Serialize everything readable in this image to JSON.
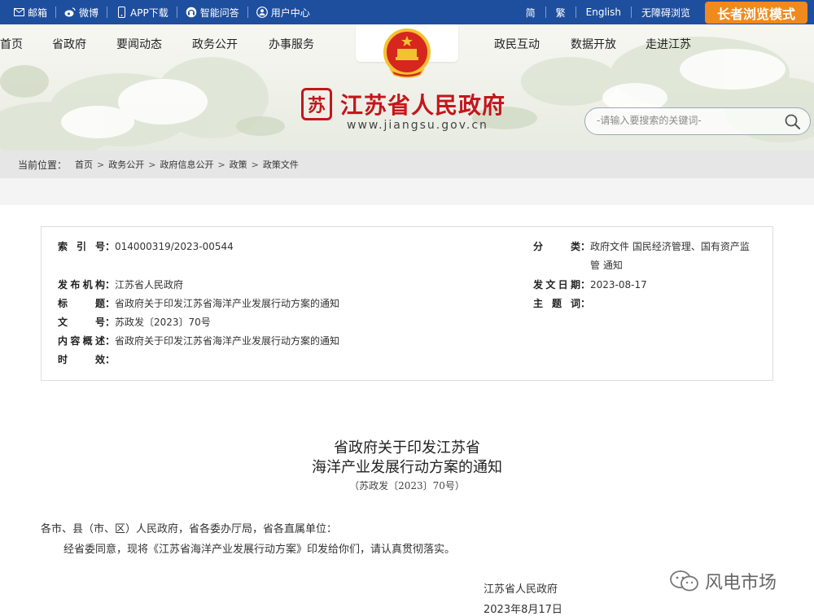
{
  "topbar": {
    "left": [
      "邮箱",
      "微博",
      "APP下载",
      "智能问答",
      "用户中心"
    ],
    "right": [
      "简",
      "繁",
      "English",
      "无障碍浏览"
    ],
    "elder": "长者浏览模式"
  },
  "nav": {
    "left": [
      "首页",
      "省政府",
      "要闻动态",
      "政务公开",
      "办事服务"
    ],
    "right": [
      "政民互动",
      "数据开放",
      "走进江苏"
    ]
  },
  "logo": {
    "seal": "苏",
    "name": "江苏省人民政府",
    "url": "www.jiangsu.gov.cn"
  },
  "search": {
    "placeholder": "-请输入要搜索的关键词-"
  },
  "breadcrumb": {
    "label": "当前位置：",
    "items": [
      "首页",
      "政务公开",
      "政府信息公开",
      "政策",
      "政策文件"
    ]
  },
  "meta": {
    "index_k": "索引号",
    "index_v": "014000319/2023-00544",
    "cat_k": "分类",
    "cat_v1": "政府文件 国民经济管理、国有资产监",
    "cat_v2": "管 通知",
    "issuer_k": "发布机构",
    "issuer_v": "江苏省人民政府",
    "date_k": "发文日期",
    "date_v": "2023-08-17",
    "title_k": "标题",
    "title_v": "省政府关于印发江苏省海洋产业发展行动方案的通知",
    "subject_k": "主题词",
    "subject_v": "",
    "docno_k": "文号",
    "docno_v": "苏政发〔2023〕70号",
    "summary_k": "内容概述",
    "summary_v": "省政府关于印发江苏省海洋产业发展行动方案的通知",
    "valid_k": "时效",
    "valid_v": ""
  },
  "doc": {
    "title1": "省政府关于印发江苏省",
    "title2": "海洋产业发展行动方案的通知",
    "number": "（苏政发〔2023〕70号）",
    "recipients": "各市、县（市、区）人民政府，省各委办厅局，省各直属单位：",
    "body": "经省委同意，现将《江苏省海洋产业发展行动方案》印发给你们，请认真贯彻落实。",
    "signer": "江苏省人民政府",
    "date": "2023年8月17日"
  },
  "watermark": "风电市场"
}
